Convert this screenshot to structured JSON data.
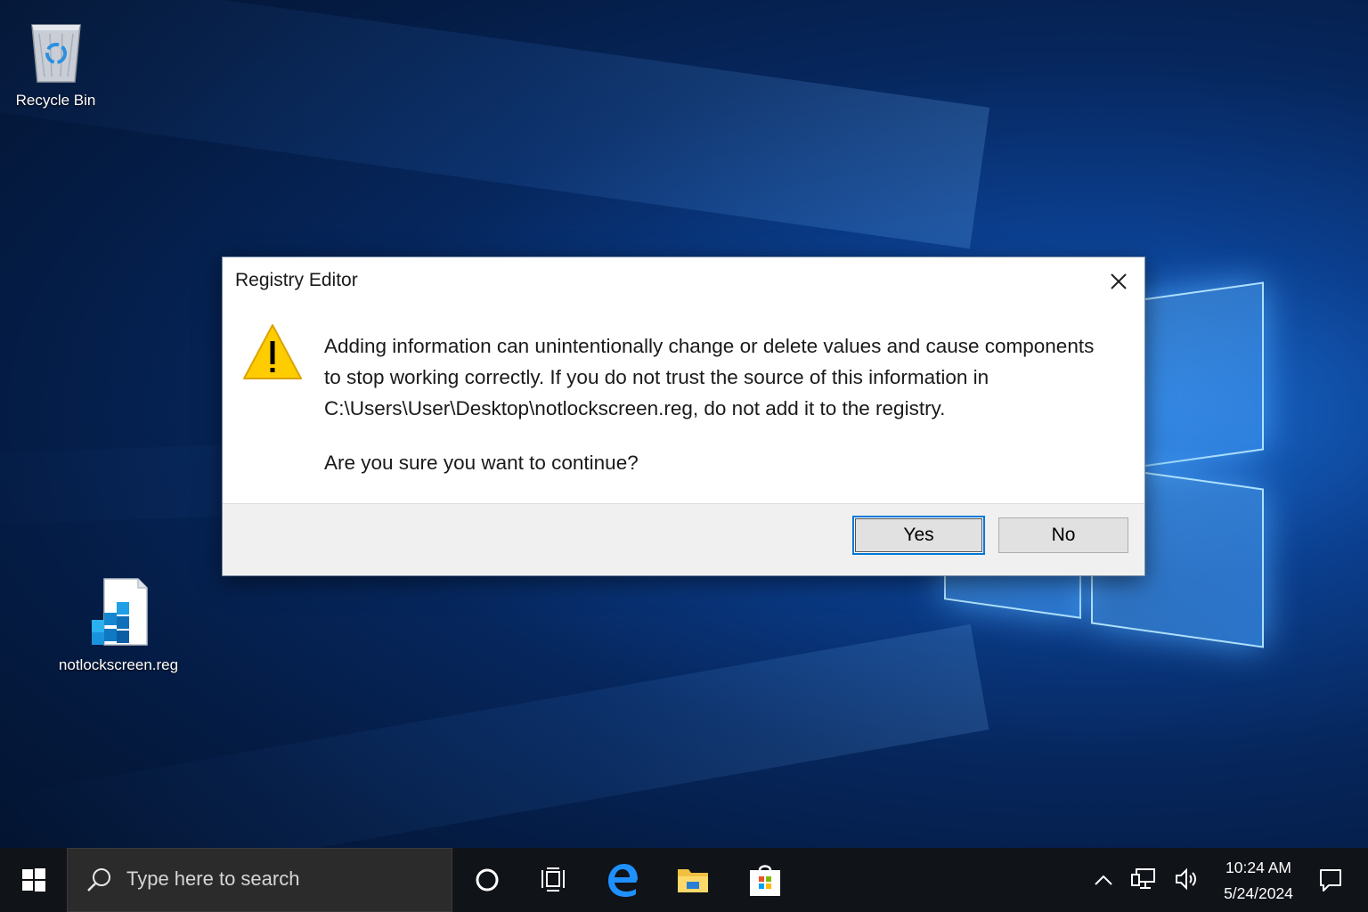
{
  "desktop": {
    "icons": [
      {
        "label": "Recycle Bin"
      },
      {
        "label": "notlockscreen.reg"
      }
    ]
  },
  "dialog": {
    "title": "Registry Editor",
    "message_lines": [
      "Adding information can unintentionally change or delete values and cause components",
      "to stop working correctly. If you do not trust the source of this information in",
      "C:\\Users\\User\\Desktop\\notlockscreen.reg, do not add it to the registry."
    ],
    "question": "Are you sure you want to continue?",
    "yes_label": "Yes",
    "no_label": "No"
  },
  "taskbar": {
    "search_placeholder": "Type here to search",
    "time": "10:24 AM",
    "date": "5/24/2024"
  },
  "colors": {
    "accent": "#0078d7",
    "warning": "#ffcc00"
  }
}
